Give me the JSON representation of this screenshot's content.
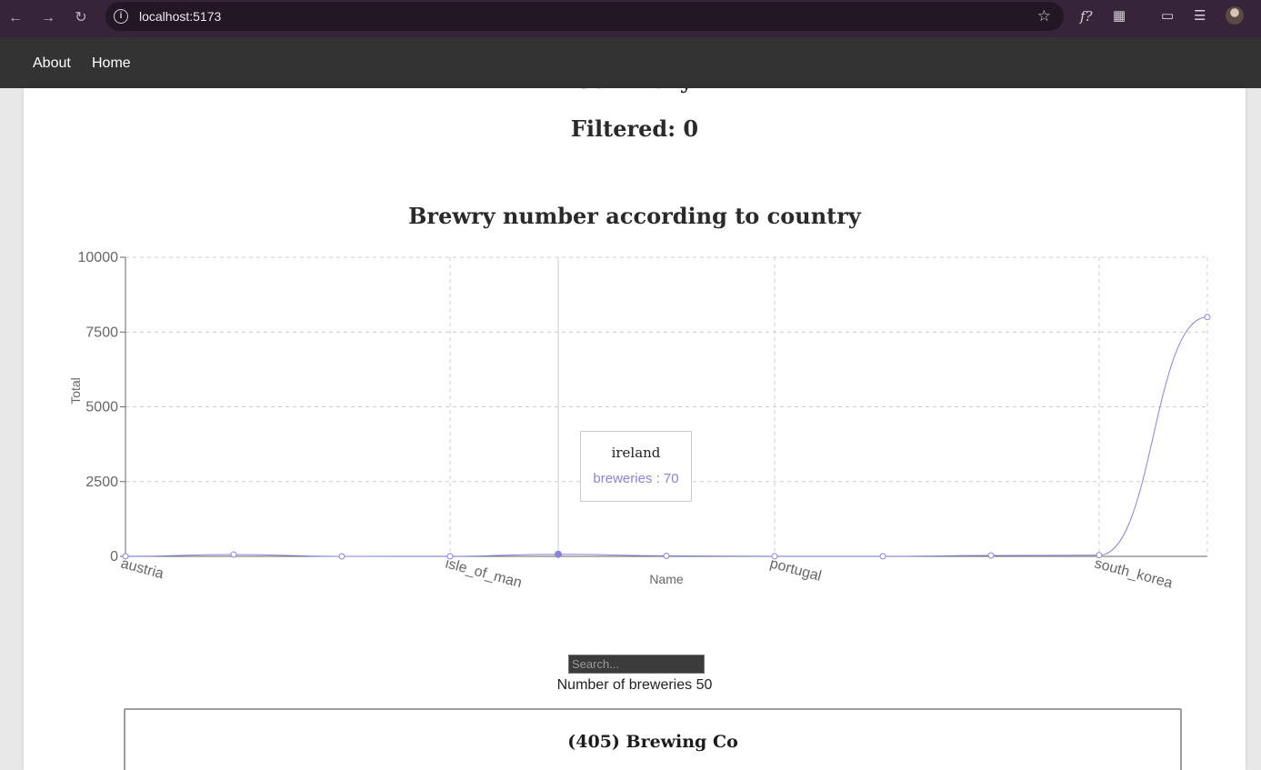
{
  "browser": {
    "url": "localhost:5173"
  },
  "nav": {
    "links": [
      "About",
      "Home"
    ]
  },
  "page": {
    "filtered_text": "Filtered: 0",
    "chart_title": "Brewry number according to country",
    "search_placeholder": "Search...",
    "count_text": "Number of breweries 50",
    "first_brewery": "(405) Brewing Co"
  },
  "tooltip": {
    "name": "ireland",
    "value_text": "breweries : 70"
  },
  "chart_data": {
    "type": "line",
    "title": "Brewry number according to country",
    "xlabel": "Name",
    "ylabel": "Total",
    "ylim": [
      0,
      10000
    ],
    "y_ticks": [
      0,
      2500,
      5000,
      7500,
      10000
    ],
    "x_tick_labels": [
      "austria",
      "isle_of_man",
      "portugal",
      "south_korea"
    ],
    "x_tick_indices": [
      0,
      3,
      6,
      9
    ],
    "grid": true,
    "color": "#8884d8",
    "series": [
      {
        "name": "breweries",
        "values": [
          4,
          60,
          1,
          3,
          70,
          20,
          2,
          3,
          30,
          40,
          8000
        ]
      }
    ],
    "active_index": 4
  }
}
